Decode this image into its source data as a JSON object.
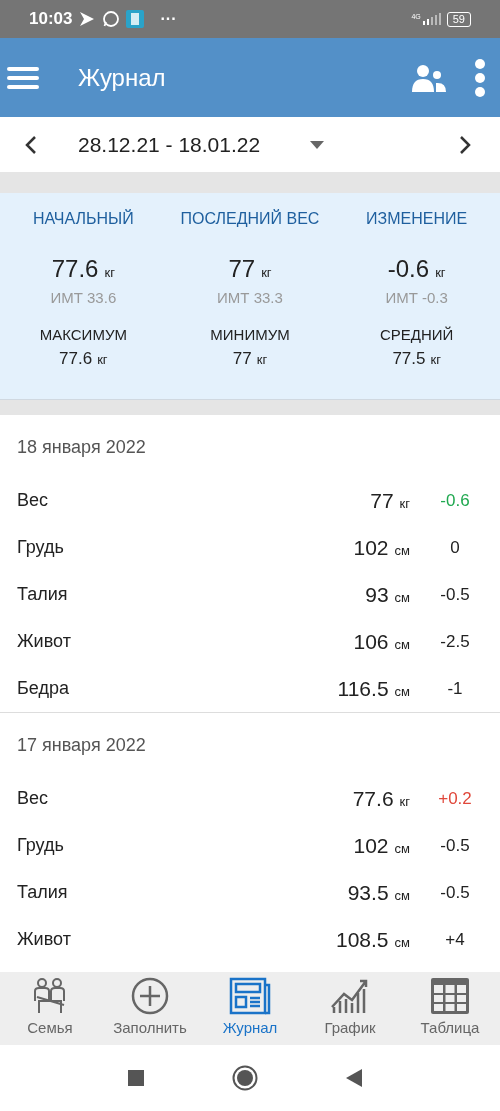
{
  "status_bar": {
    "time": "10:03",
    "more": "···",
    "network": "4G",
    "battery": "59"
  },
  "app_bar": {
    "title": "Журнал"
  },
  "date_range": {
    "text": "28.12.21 - 18.01.22"
  },
  "summary": {
    "top": [
      {
        "label": "НАЧАЛЬНЫЙ",
        "value": "77.6",
        "unit": "кг",
        "bmi": "ИМТ 33.6"
      },
      {
        "label": "ПОСЛЕДНИЙ ВЕС",
        "value": "77",
        "unit": "кг",
        "bmi": "ИМТ 33.3"
      },
      {
        "label": "ИЗМЕНЕНИЕ",
        "value": "-0.6",
        "unit": "кг",
        "bmi": "ИМТ -0.3"
      }
    ],
    "bottom": [
      {
        "label": "МАКСИМУМ",
        "value": "77.6",
        "unit": "кг"
      },
      {
        "label": "МИНИМУМ",
        "value": "77",
        "unit": "кг"
      },
      {
        "label": "СРЕДНИЙ",
        "value": "77.5",
        "unit": "кг"
      }
    ]
  },
  "days": [
    {
      "date": "18 января 2022",
      "rows": [
        {
          "label": "Вес",
          "value": "77",
          "unit": "кг",
          "change": "-0.6",
          "color": "#1fa84f"
        },
        {
          "label": "Грудь",
          "value": "102",
          "unit": "см",
          "change": "0",
          "color": "#222222"
        },
        {
          "label": "Талия",
          "value": "93",
          "unit": "см",
          "change": "-0.5",
          "color": "#222222"
        },
        {
          "label": "Живот",
          "value": "106",
          "unit": "см",
          "change": "-2.5",
          "color": "#222222"
        },
        {
          "label": "Бедра",
          "value": "116.5",
          "unit": "см",
          "change": "-1",
          "color": "#222222"
        }
      ]
    },
    {
      "date": "17 января 2022",
      "rows": [
        {
          "label": "Вес",
          "value": "77.6",
          "unit": "кг",
          "change": "+0.2",
          "color": "#e0473a"
        },
        {
          "label": "Грудь",
          "value": "102",
          "unit": "см",
          "change": "-0.5",
          "color": "#222222"
        },
        {
          "label": "Талия",
          "value": "93.5",
          "unit": "см",
          "change": "-0.5",
          "color": "#222222"
        },
        {
          "label": "Живот",
          "value": "108.5",
          "unit": "см",
          "change": "+4",
          "color": "#222222"
        }
      ]
    }
  ],
  "bottom_nav": [
    {
      "kind": "family",
      "label": "Семья",
      "selected": false
    },
    {
      "kind": "add",
      "label": "Заполнить",
      "selected": false
    },
    {
      "kind": "journal",
      "label": "Журнал",
      "selected": true
    },
    {
      "kind": "chart",
      "label": "График",
      "selected": false
    },
    {
      "kind": "table",
      "label": "Таблица",
      "selected": false
    }
  ]
}
